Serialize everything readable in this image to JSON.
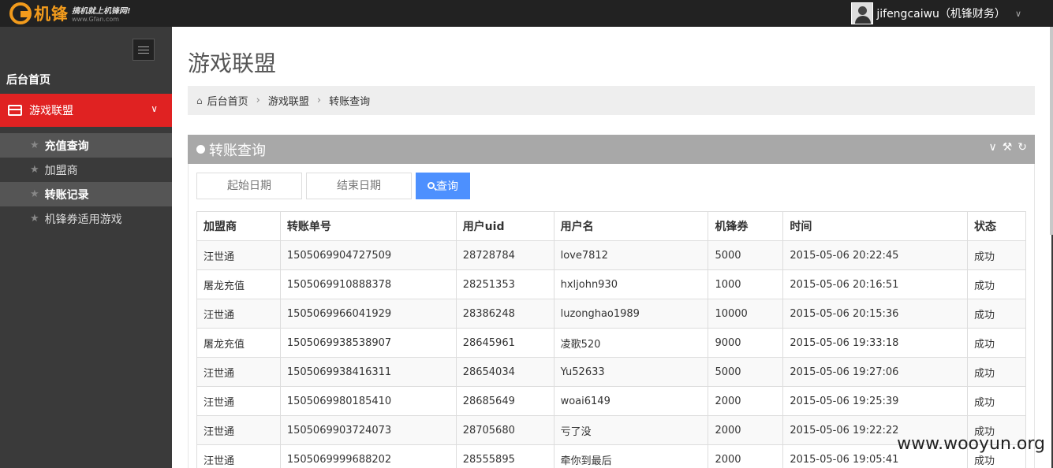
{
  "logo": {
    "name": "机锋",
    "slogan": "搞机就上机锋网!",
    "url": "www.Gfan.com"
  },
  "user": {
    "name": "jifengcaiwu（机锋财务）"
  },
  "sidebar": {
    "home": "后台首页",
    "active_menu": "游戏联盟",
    "items": [
      {
        "label": "充值查询",
        "highlighted": true
      },
      {
        "label": "加盟商",
        "highlighted": false
      },
      {
        "label": "转账记录",
        "highlighted": true
      },
      {
        "label": "机锋券适用游戏",
        "highlighted": false
      }
    ]
  },
  "page": {
    "title": "游戏联盟"
  },
  "breadcrumb": [
    "后台首页",
    "游戏联盟",
    "转账查询"
  ],
  "portlet": {
    "title": "转账查询"
  },
  "filters": {
    "start_placeholder": "起始日期",
    "end_placeholder": "结束日期",
    "search_label": "查询"
  },
  "table": {
    "columns": [
      "加盟商",
      "转账单号",
      "用户uid",
      "用户名",
      "机锋券",
      "时间",
      "状态"
    ],
    "rows": [
      [
        "汪世通",
        "1505069904727509",
        "28728784",
        "love7812",
        "5000",
        "2015-05-06 20:22:45",
        "成功"
      ],
      [
        "屠龙充值",
        "1505069910888378",
        "28251353",
        "hxljohn930",
        "1000",
        "2015-05-06 20:16:51",
        "成功"
      ],
      [
        "汪世通",
        "1505069966041929",
        "28386248",
        "luzonghao1989",
        "10000",
        "2015-05-06 20:15:36",
        "成功"
      ],
      [
        "屠龙充值",
        "1505069938538907",
        "28645961",
        "凌歌520",
        "9000",
        "2015-05-06 19:33:18",
        "成功"
      ],
      [
        "汪世通",
        "1505069938416311",
        "28654034",
        "Yu52633",
        "5000",
        "2015-05-06 19:27:06",
        "成功"
      ],
      [
        "汪世通",
        "1505069980185410",
        "28685649",
        "woai6149",
        "2000",
        "2015-05-06 19:25:39",
        "成功"
      ],
      [
        "汪世通",
        "1505069903724073",
        "28705680",
        "亏了没",
        "2000",
        "2015-05-06 19:22:22",
        "成功"
      ],
      [
        "汪世通",
        "1505069999688202",
        "28555895",
        "牵你到最后",
        "2000",
        "2015-05-06 19:05:41",
        "成功"
      ]
    ]
  },
  "watermark": "www.wooyun.org"
}
